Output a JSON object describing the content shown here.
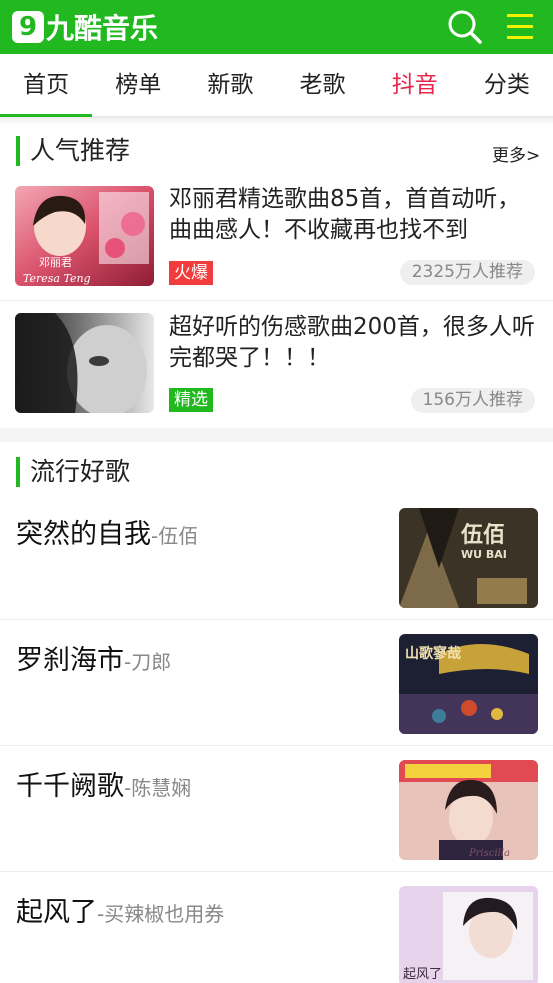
{
  "header": {
    "logo_badge": "9",
    "logo_text": "九酷音乐"
  },
  "tabs": [
    {
      "label": "首页"
    },
    {
      "label": "榜单"
    },
    {
      "label": "新歌"
    },
    {
      "label": "老歌"
    },
    {
      "label": "抖音"
    },
    {
      "label": "分类"
    }
  ],
  "popular": {
    "title": "人气推荐",
    "more": "更多>",
    "items": [
      {
        "title": "邓丽君精选歌曲85首，首首动听，曲曲感人！不收藏再也找不到",
        "badge": "火爆",
        "badge_color": "#f03c3c",
        "count": "2325万人推荐",
        "cover_text": "邓丽君",
        "cover_sub": "Teresa Teng"
      },
      {
        "title": "超好听的伤感歌曲200首，很多人听完都哭了！！！",
        "badge": "精选",
        "badge_color": "#21b820",
        "count": "156万人推荐"
      }
    ]
  },
  "hits": {
    "title": "流行好歌",
    "songs": [
      {
        "name": "突然的自我",
        "artist": "-伍佰",
        "cover_text": "伍佰",
        "cover_sub": "WU BAI"
      },
      {
        "name": "罗刹海市",
        "artist": "-刀郎",
        "cover_text": "山歌寥哉"
      },
      {
        "name": "千千阙歌",
        "artist": "-陈慧娴",
        "cover_sub": "Priscilla"
      },
      {
        "name": "起风了",
        "artist": "-买辣椒也用券",
        "cover_text": "起风了"
      }
    ]
  },
  "colors": {
    "brand_green": "#21b820",
    "hot_red": "#e6264b"
  }
}
